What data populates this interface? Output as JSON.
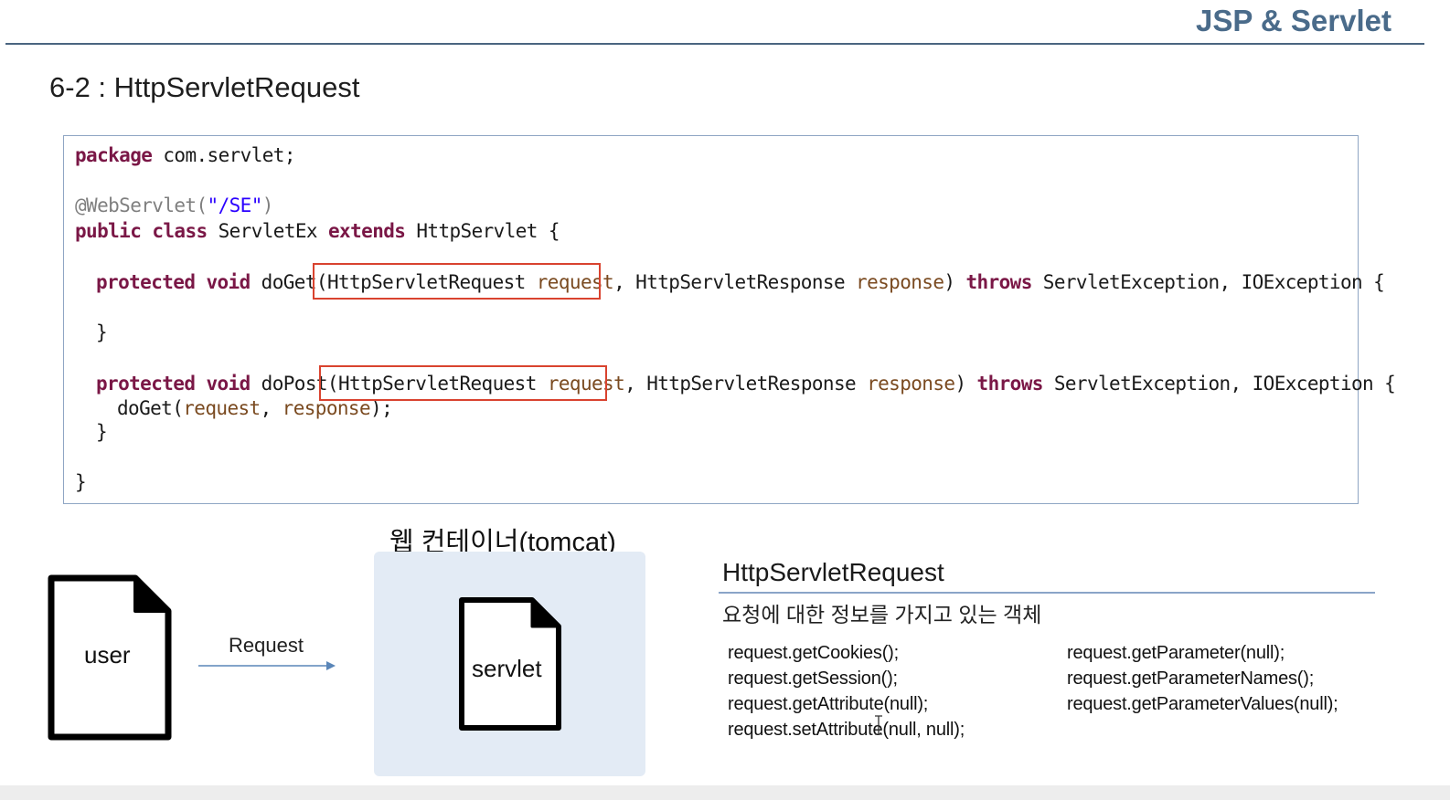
{
  "header": {
    "brand": "JSP & Servlet"
  },
  "slide": {
    "title": "6-2 : HttpServletRequest"
  },
  "code": {
    "l1": {
      "kw": "package",
      "rest": " com.servlet;"
    },
    "l2": {
      "ann": "@WebServlet(",
      "str": "\"/SE\"",
      "close": ")"
    },
    "l3": {
      "kw1": "public",
      "kw2": "class",
      "name": " ServletEx ",
      "kw3": "extends",
      "rest": " HttpServlet {"
    },
    "l4": {
      "kw1": "protected",
      "kw2": "void",
      "method": " doGet(",
      "ptype": "HttpServletRequest ",
      "pvar": "request",
      "sep": ", HttpServletResponse ",
      "rvar": "response",
      "close": ") ",
      "kw3": "throws",
      "rest": " ServletException, IOException {"
    },
    "l5": "}",
    "l6": {
      "kw1": "protected",
      "kw2": "void",
      "method": " doPost(",
      "ptype": "HttpServletRequest ",
      "pvar": "request",
      "sep": ", HttpServletResponse ",
      "rvar": "response",
      "close": ") ",
      "kw3": "throws",
      "rest": " ServletException, IOException {"
    },
    "l7": {
      "call": "doGet(",
      "a1": "request",
      "comma": ", ",
      "a2": "response",
      "end": ");"
    },
    "l8": "}",
    "l9": "}"
  },
  "diagram": {
    "container_label": "웹 컨테이너(tomcat)",
    "user_label": "user",
    "servlet_label": "servlet",
    "request_label": "Request"
  },
  "request_info": {
    "title": "HttpServletRequest",
    "description": "요청에 대한 정보를 가지고 있는 객체",
    "methods_left": [
      "request.getCookies();",
      "request.getSession();",
      "request.getAttribute(null);",
      "request.setAttribute(null, null);"
    ],
    "methods_right": [
      "request.getParameter(null);",
      "request.getParameterNames();",
      "request.getParameterValues(null);"
    ]
  },
  "colors": {
    "brand": "#4a6b8a",
    "keyword": "#7a1746",
    "annotation": "#7f7f7f",
    "string": "#2a00ff",
    "highlight_box": "#d9432f",
    "container_bg": "#e3ebf5"
  }
}
